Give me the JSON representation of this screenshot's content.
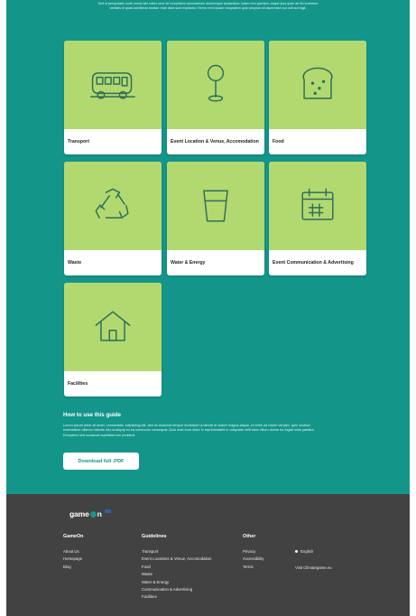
{
  "intro": {
    "line1": "Sed ut perspiciatis unde omnis iste natus error sit voluptatem accusantium doloremque laudantium, totam rem aperiam, eaque ipsa quae ab illo inventore veritatis et quasi architecto beatae vitae dicta sunt explicabo. Nemo enim ipsam voluptatem quia voluptas sit aspernatur aut odit aut fugit."
  },
  "cards": [
    {
      "label": "Transport",
      "icon": "bus-icon"
    },
    {
      "label": "Event Location & Venue, Accomodation",
      "icon": "location-pin-icon"
    },
    {
      "label": "Food",
      "icon": "bread-icon"
    },
    {
      "label": "Waste",
      "icon": "recycle-icon"
    },
    {
      "label": "Water & Energy",
      "icon": "glass-icon"
    },
    {
      "label": "Event Communication & Advertising",
      "icon": "calendar-icon"
    },
    {
      "label": "Facilities",
      "icon": "house-icon"
    }
  ],
  "howto": {
    "title": "How to use this guide",
    "body": "Lorem ipsum dolor sit amet, consectetur adipiscing elit, sed do eiusmod tempor incididunt ut labore et dolore magna aliqua. Ut enim ad minim veniam, quis nostrud exercitation ullamco laboris nisi ut aliquip ex ea commodo consequat. Duis aute irure dolor in reprehenderit in voluptate velit esse cillum dolore eu fugiat nulla pariatur. Excepteur sint occaecat cupidatat non proident.",
    "download_label": "Download full .PDF"
  },
  "footer": {
    "logo": {
      "word_a": "game",
      "word_b": "n"
    },
    "col1": {
      "title": "GameOn",
      "links": [
        "About Us",
        "Homepage",
        "Blog"
      ]
    },
    "col2": {
      "title": "Guidelines",
      "links": [
        "Transport",
        "Event Locations & Venue, Accomodation",
        "Food",
        "Waste",
        "Water & Energy",
        "Communication & Advertising",
        "Facilities"
      ]
    },
    "col3": {
      "title": "Other",
      "links": [
        "Privacy",
        "Accessibility",
        "Terms"
      ]
    },
    "language": "English",
    "visit": "Visit Climategame.eu"
  },
  "colors": {
    "teal": "#14958a",
    "card_green": "#b2d970",
    "footer": "#424242"
  }
}
